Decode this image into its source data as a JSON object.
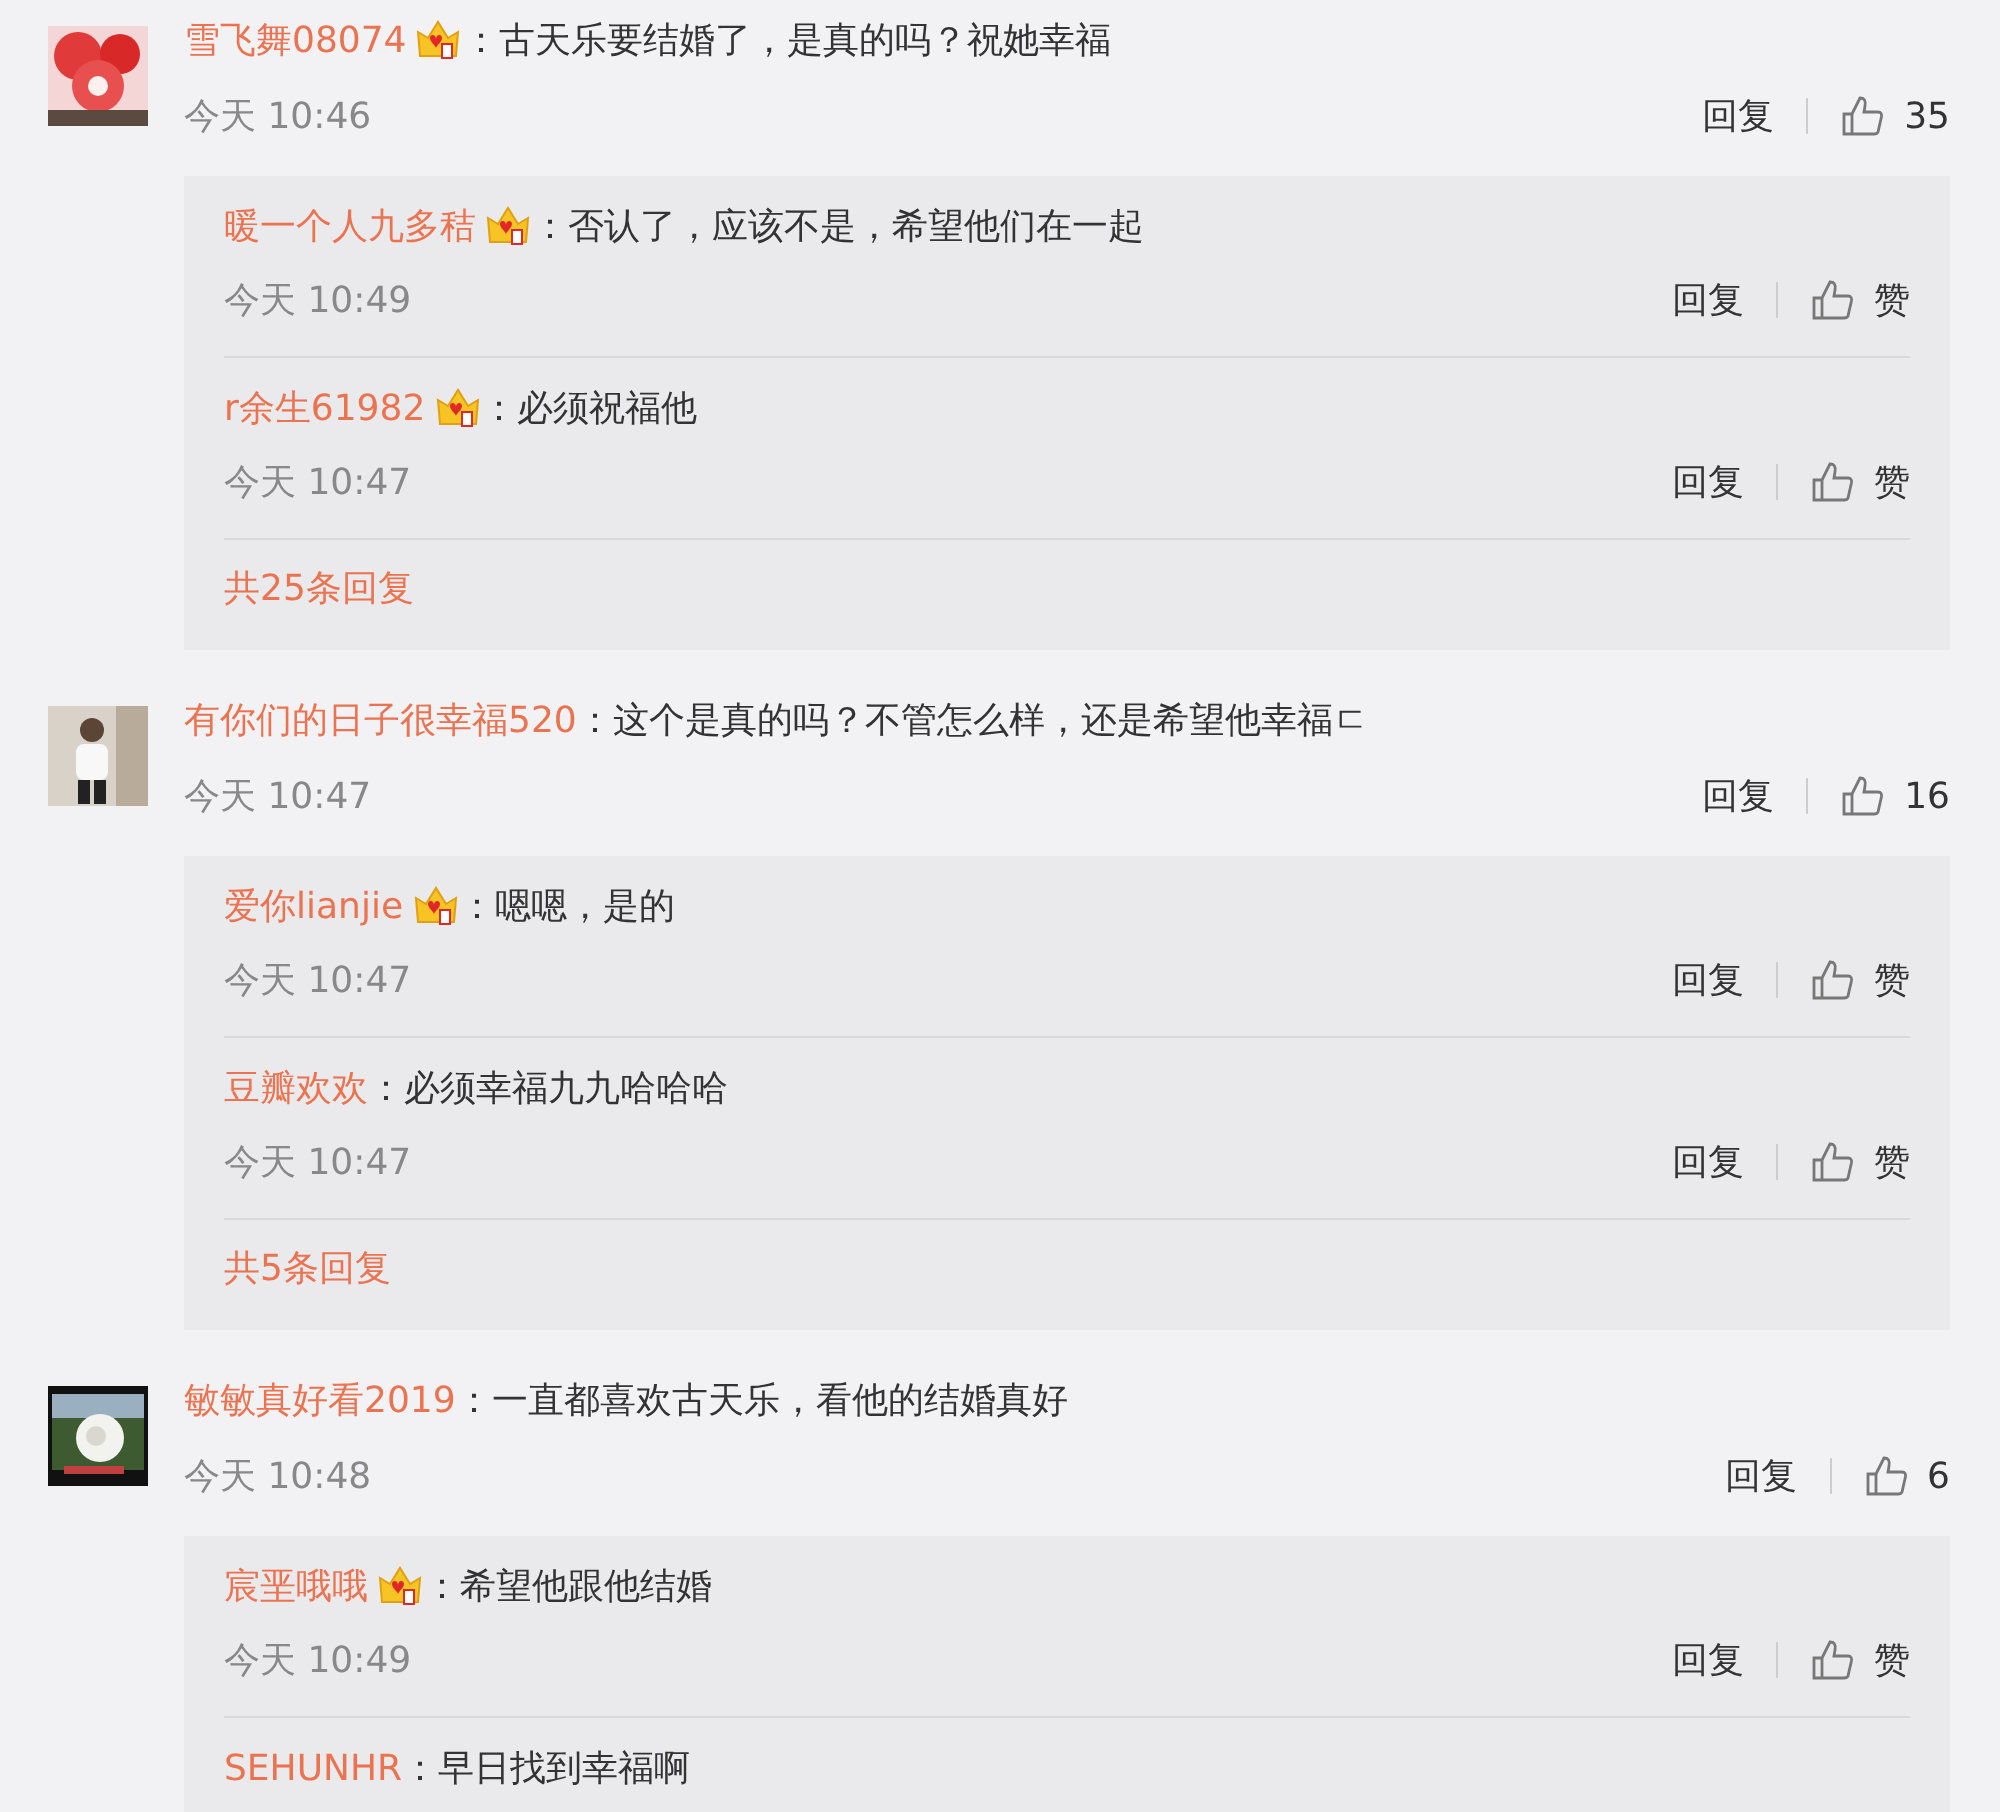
{
  "comments": [
    {
      "user": "雪飞舞08074",
      "badge": true,
      "text": "：古天乐要结婚了，是真的吗？祝她幸福",
      "time": "今天 10:46",
      "reply_label": "回复",
      "likes": "35",
      "replies": [
        {
          "user": "暖一个人九多秸",
          "badge": true,
          "text": "：否认了，应该不是，希望他们在一起",
          "time": "今天 10:49",
          "reply_label": "回复",
          "like_label": "赞"
        },
        {
          "user": "r余生61982",
          "badge": true,
          "text": "：必须祝福他",
          "time": "今天 10:47",
          "reply_label": "回复",
          "like_label": "赞"
        }
      ],
      "more_replies": "共25条回复"
    },
    {
      "user": "有你们的日子很幸福520",
      "badge": false,
      "text": "：这个是真的吗？不管怎么样，还是希望他幸福ㄷ",
      "time": "今天 10:47",
      "reply_label": "回复",
      "likes": "16",
      "replies": [
        {
          "user": "爱你lianjie",
          "badge": true,
          "text": "：嗯嗯，是的",
          "time": "今天 10:47",
          "reply_label": "回复",
          "like_label": "赞"
        },
        {
          "user": "豆瓣欢欢",
          "badge": false,
          "text": "：必须幸福九九哈哈哈",
          "time": "今天 10:47",
          "reply_label": "回复",
          "like_label": "赞"
        }
      ],
      "more_replies": "共5条回复"
    },
    {
      "user": "敏敏真好看2019",
      "badge": false,
      "text": "：一直都喜欢古天乐，看他的结婚真好",
      "time": "今天 10:48",
      "reply_label": "回复",
      "likes": "6",
      "replies": [
        {
          "user": "宸垩哦哦",
          "badge": true,
          "text": "：希望他跟他结婚",
          "time": "今天 10:49",
          "reply_label": "回复",
          "like_label": "赞"
        },
        {
          "user": "SEHUNHR",
          "badge": false,
          "text": "：早日找到幸福啊"
        }
      ]
    }
  ]
}
